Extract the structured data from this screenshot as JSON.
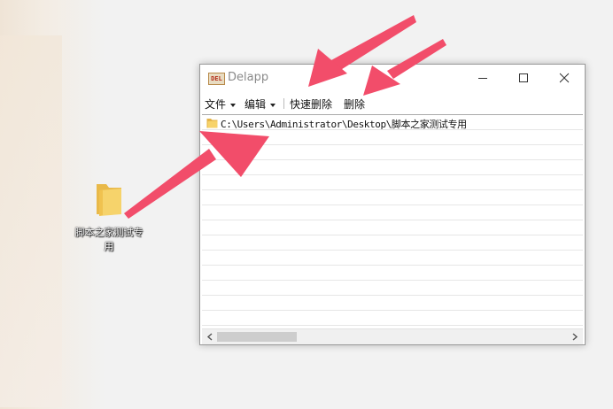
{
  "desktop": {
    "folder_label": "脚本之家测试专用"
  },
  "window": {
    "app_icon_text": "DEL",
    "title": "Delapp",
    "controls": [
      "minimize-icon",
      "maximize-icon",
      "close-icon"
    ]
  },
  "menu": {
    "file": "文件",
    "edit": "编辑",
    "fast_delete": "快速删除",
    "delete": "删除"
  },
  "list": {
    "items": [
      {
        "path": "C:\\Users\\Administrator\\Desktop\\脚本之家测试专用",
        "icon": "folder-icon"
      }
    ]
  },
  "colors": {
    "annotation_arrow": "#f24d6a",
    "folder": "#f3c95a"
  }
}
